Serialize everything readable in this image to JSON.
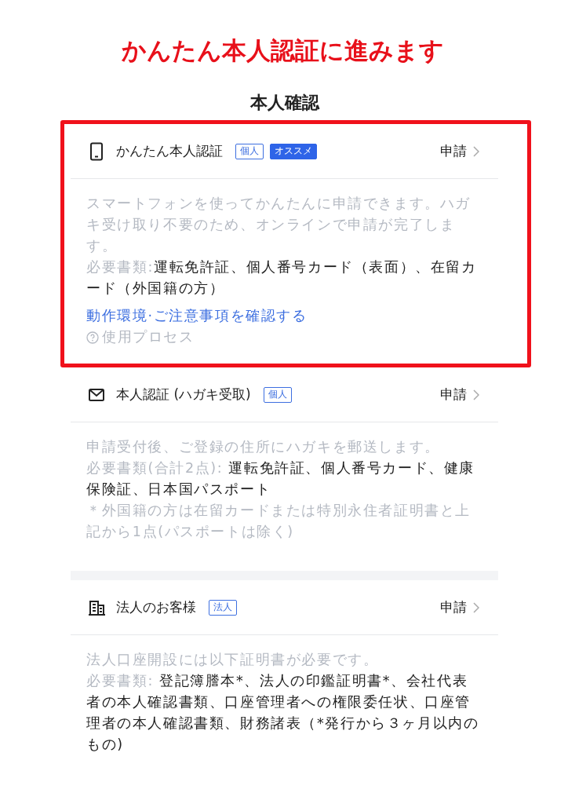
{
  "banner": "かんたん本人認証に進みます",
  "title": "本人確認",
  "groups": [
    {
      "sections": [
        {
          "kind": "phone",
          "highlighted": true,
          "title": "かんたん本人認証",
          "tags": [
            {
              "label": "個人",
              "kind": "outline"
            },
            {
              "label": "オススメ",
              "kind": "solid"
            }
          ],
          "action": "申請",
          "body": [
            {
              "kind": "note",
              "text": "スマートフォンを使ってかんたんに申請できます。ハガキ受け取り不要のため、オンラインで申請が完了します。"
            },
            {
              "kind": "requirement",
              "label": "必要書類:",
              "value": "運転免許証、個人番号カード（表面）、在留カード（外国籍の方）"
            }
          ],
          "link": "動作環境·ご注意事項を確認する",
          "help": "使用プロセス"
        },
        {
          "kind": "mail",
          "highlighted": false,
          "title": "本人認証 (ハガキ受取)",
          "tags": [
            {
              "label": "個人",
              "kind": "outline"
            }
          ],
          "action": "申請",
          "body": [
            {
              "kind": "note",
              "text": "申請受付後、ご登録の住所にハガキを郵送します。"
            },
            {
              "kind": "requirement",
              "label": "必要書類(合計2点): ",
              "value": "運転免許証、個人番号カード、健康保険証、日本国パスポート"
            },
            {
              "kind": "note",
              "text": "＊外国籍の方は在留カードまたは特別永住者証明書と上記から1点(パスポートは除く)"
            }
          ]
        }
      ]
    },
    {
      "sections": [
        {
          "kind": "building",
          "highlighted": false,
          "title": "法人のお客様",
          "tags": [
            {
              "label": "法人",
              "kind": "outline"
            }
          ],
          "action": "申請",
          "body": [
            {
              "kind": "note",
              "text": "法人口座開設には以下証明書が必要です。"
            },
            {
              "kind": "requirement",
              "label": "必要書類: ",
              "value": "登記簿謄本*、法人の印鑑証明書*、会社代表者の本人確認書類、口座管理者への権限委任状、口座管理者の本人確認書類、財務諸表（*発行から３ヶ月以内のもの)"
            }
          ]
        }
      ]
    }
  ]
}
